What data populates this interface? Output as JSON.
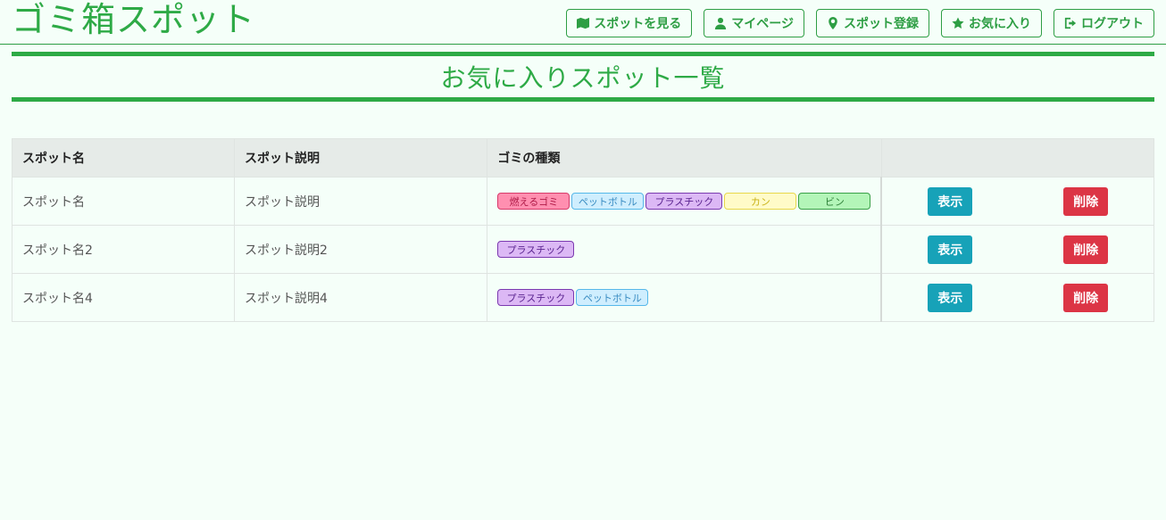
{
  "brand": "ゴミ箱スポット",
  "nav": [
    {
      "label": "スポットを見る",
      "icon": "map-icon"
    },
    {
      "label": "マイページ",
      "icon": "user-icon"
    },
    {
      "label": "スポット登録",
      "icon": "map-pin-icon"
    },
    {
      "label": "お気に入り",
      "icon": "star-icon"
    },
    {
      "label": "ログアウト",
      "icon": "logout-icon"
    }
  ],
  "page_title": "お気に入りスポット一覧",
  "table": {
    "headers": [
      "スポット名",
      "スポット説明",
      "ゴミの種類",
      ""
    ],
    "rows": [
      {
        "name": "スポット名",
        "desc": "スポット説明",
        "tags": [
          "燃えるゴミ",
          "ペットボトル",
          "プラスチック",
          "カン",
          "ビン"
        ],
        "show": "表示",
        "delete": "削除"
      },
      {
        "name": "スポット名2",
        "desc": "スポット説明2",
        "tags": [
          "プラスチック"
        ],
        "show": "表示",
        "delete": "削除"
      },
      {
        "name": "スポット名4",
        "desc": "スポット説明4",
        "tags": [
          "プラスチック",
          "ペットボトル"
        ],
        "show": "表示",
        "delete": "削除"
      }
    ]
  },
  "colors": {
    "accent": "#2eaa46",
    "show_button": "#17a2b8",
    "delete_button": "#dc3545"
  }
}
